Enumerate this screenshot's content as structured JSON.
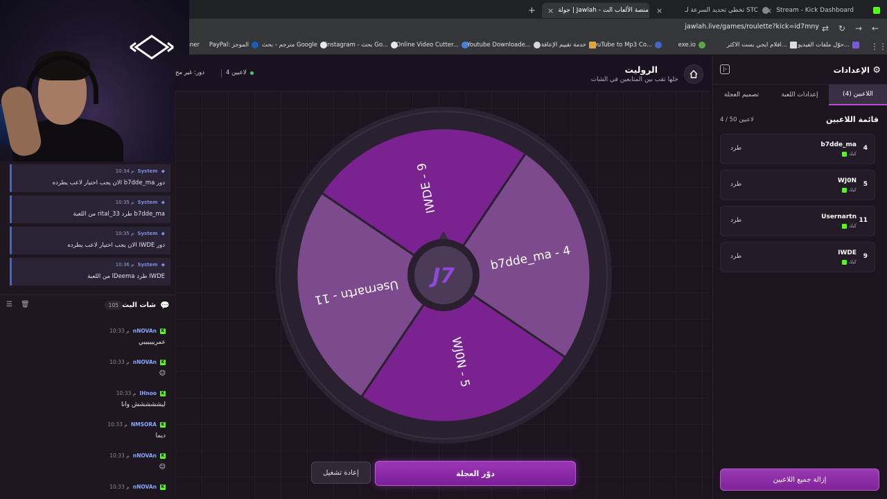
{
  "browser": {
    "tabs": [
      {
        "label": "Stream - Kick Dashboard"
      },
      {
        "label": "تخطي تحديد السرعة لـ STC"
      },
      {
        "label": "جولة | Jawlah - منصة الألعاب الت"
      }
    ],
    "url": "jawlah.live/games/roulette?kick=id7mny",
    "bookmarks": [
      {
        "label": "حوّل ملفات الفيديو و..."
      },
      {
        "label": "افلام ايجي بست الاكثر..."
      },
      {
        "label": "exe.io"
      },
      {
        "label": "YouTube to Mp3 Co..."
      },
      {
        "label": "خدمة تقييم الإعاقة"
      },
      {
        "label": "Youtube Downloade..."
      },
      {
        "label": "Online Video Cutter..."
      },
      {
        "label": "instagram - بحث Go..."
      },
      {
        "label": "مترجم - بحث Google"
      },
      {
        "label": "PayPal: الموجز"
      },
      {
        "label": "nner"
      }
    ]
  },
  "chat": {
    "system_messages": [
      {
        "user": "System",
        "time": "10:34 م",
        "text": "دور b7dde_ma الان يجب اختيار لاعب يطرده"
      },
      {
        "user": "System",
        "time": "10:35 م",
        "text": "b7dde_ma طرد rital_33 من اللعبة"
      },
      {
        "user": "System",
        "time": "10:35 م",
        "text": "دور IWDE الان يجب اختيار لاعب يطرده"
      },
      {
        "user": "System",
        "time": "10:36 م",
        "text": "IWDE طرد lDeema من اللعبة"
      }
    ],
    "title": "شات البث",
    "count": "105",
    "messages": [
      {
        "user": "nNOVAn",
        "time": "10:33 م",
        "text": "عمرييييييي"
      },
      {
        "user": "nNOVAn",
        "time": "10:33 م",
        "text": "😑"
      },
      {
        "user": "IHnoo",
        "time": "10:33 م",
        "text": "ليششششش وانا"
      },
      {
        "user": "NMSORA",
        "time": "10:33 م",
        "text": "ديما"
      },
      {
        "user": "nNOVAn",
        "time": "10:33 م",
        "text": "😑"
      },
      {
        "user": "nNOVAn",
        "time": "10:33 م",
        "text": ""
      }
    ]
  },
  "game": {
    "title": "الروليت",
    "subtitle": "خلها تقب بين المتابعين في الشات",
    "players_count": "4 لاعبين",
    "turn": "دور: غير مح",
    "wheel_segments": [
      {
        "label": "IWDE - 9",
        "color": "#7a2290"
      },
      {
        "label": "b7dde_ma - 4",
        "color": "#7d4b8d"
      },
      {
        "label": "WJ0N - 5",
        "color": "#7a2290"
      },
      {
        "label": "Usernartn - 11",
        "color": "#7d4b8d"
      }
    ],
    "spin_label": "دوّر العجلة",
    "reset_label": "إعادة تشغيل"
  },
  "settings": {
    "title": "الإعدادات",
    "tabs": [
      {
        "label": "اللاعبين (4)"
      },
      {
        "label": "إعدادات اللعبة"
      },
      {
        "label": "تصميم العجلة"
      }
    ],
    "list_title": "قائمة اللاعبين",
    "list_count": "4 / 50 لاعبين",
    "players": [
      {
        "num": "4",
        "name": "b7dde_ma",
        "platform": "كيك",
        "action": "طرد"
      },
      {
        "num": "5",
        "name": "WJ0N",
        "platform": "كيك",
        "action": "طرد"
      },
      {
        "num": "11",
        "name": "Usernartn",
        "platform": "كيك",
        "action": "طرد"
      },
      {
        "num": "9",
        "name": "IWDE",
        "platform": "كيك",
        "action": "طرد"
      }
    ],
    "remove_all_label": "إزالة جميع اللاعبين"
  },
  "colors": {
    "accent": "#9b37b6",
    "kick_green": "#53fc18"
  }
}
